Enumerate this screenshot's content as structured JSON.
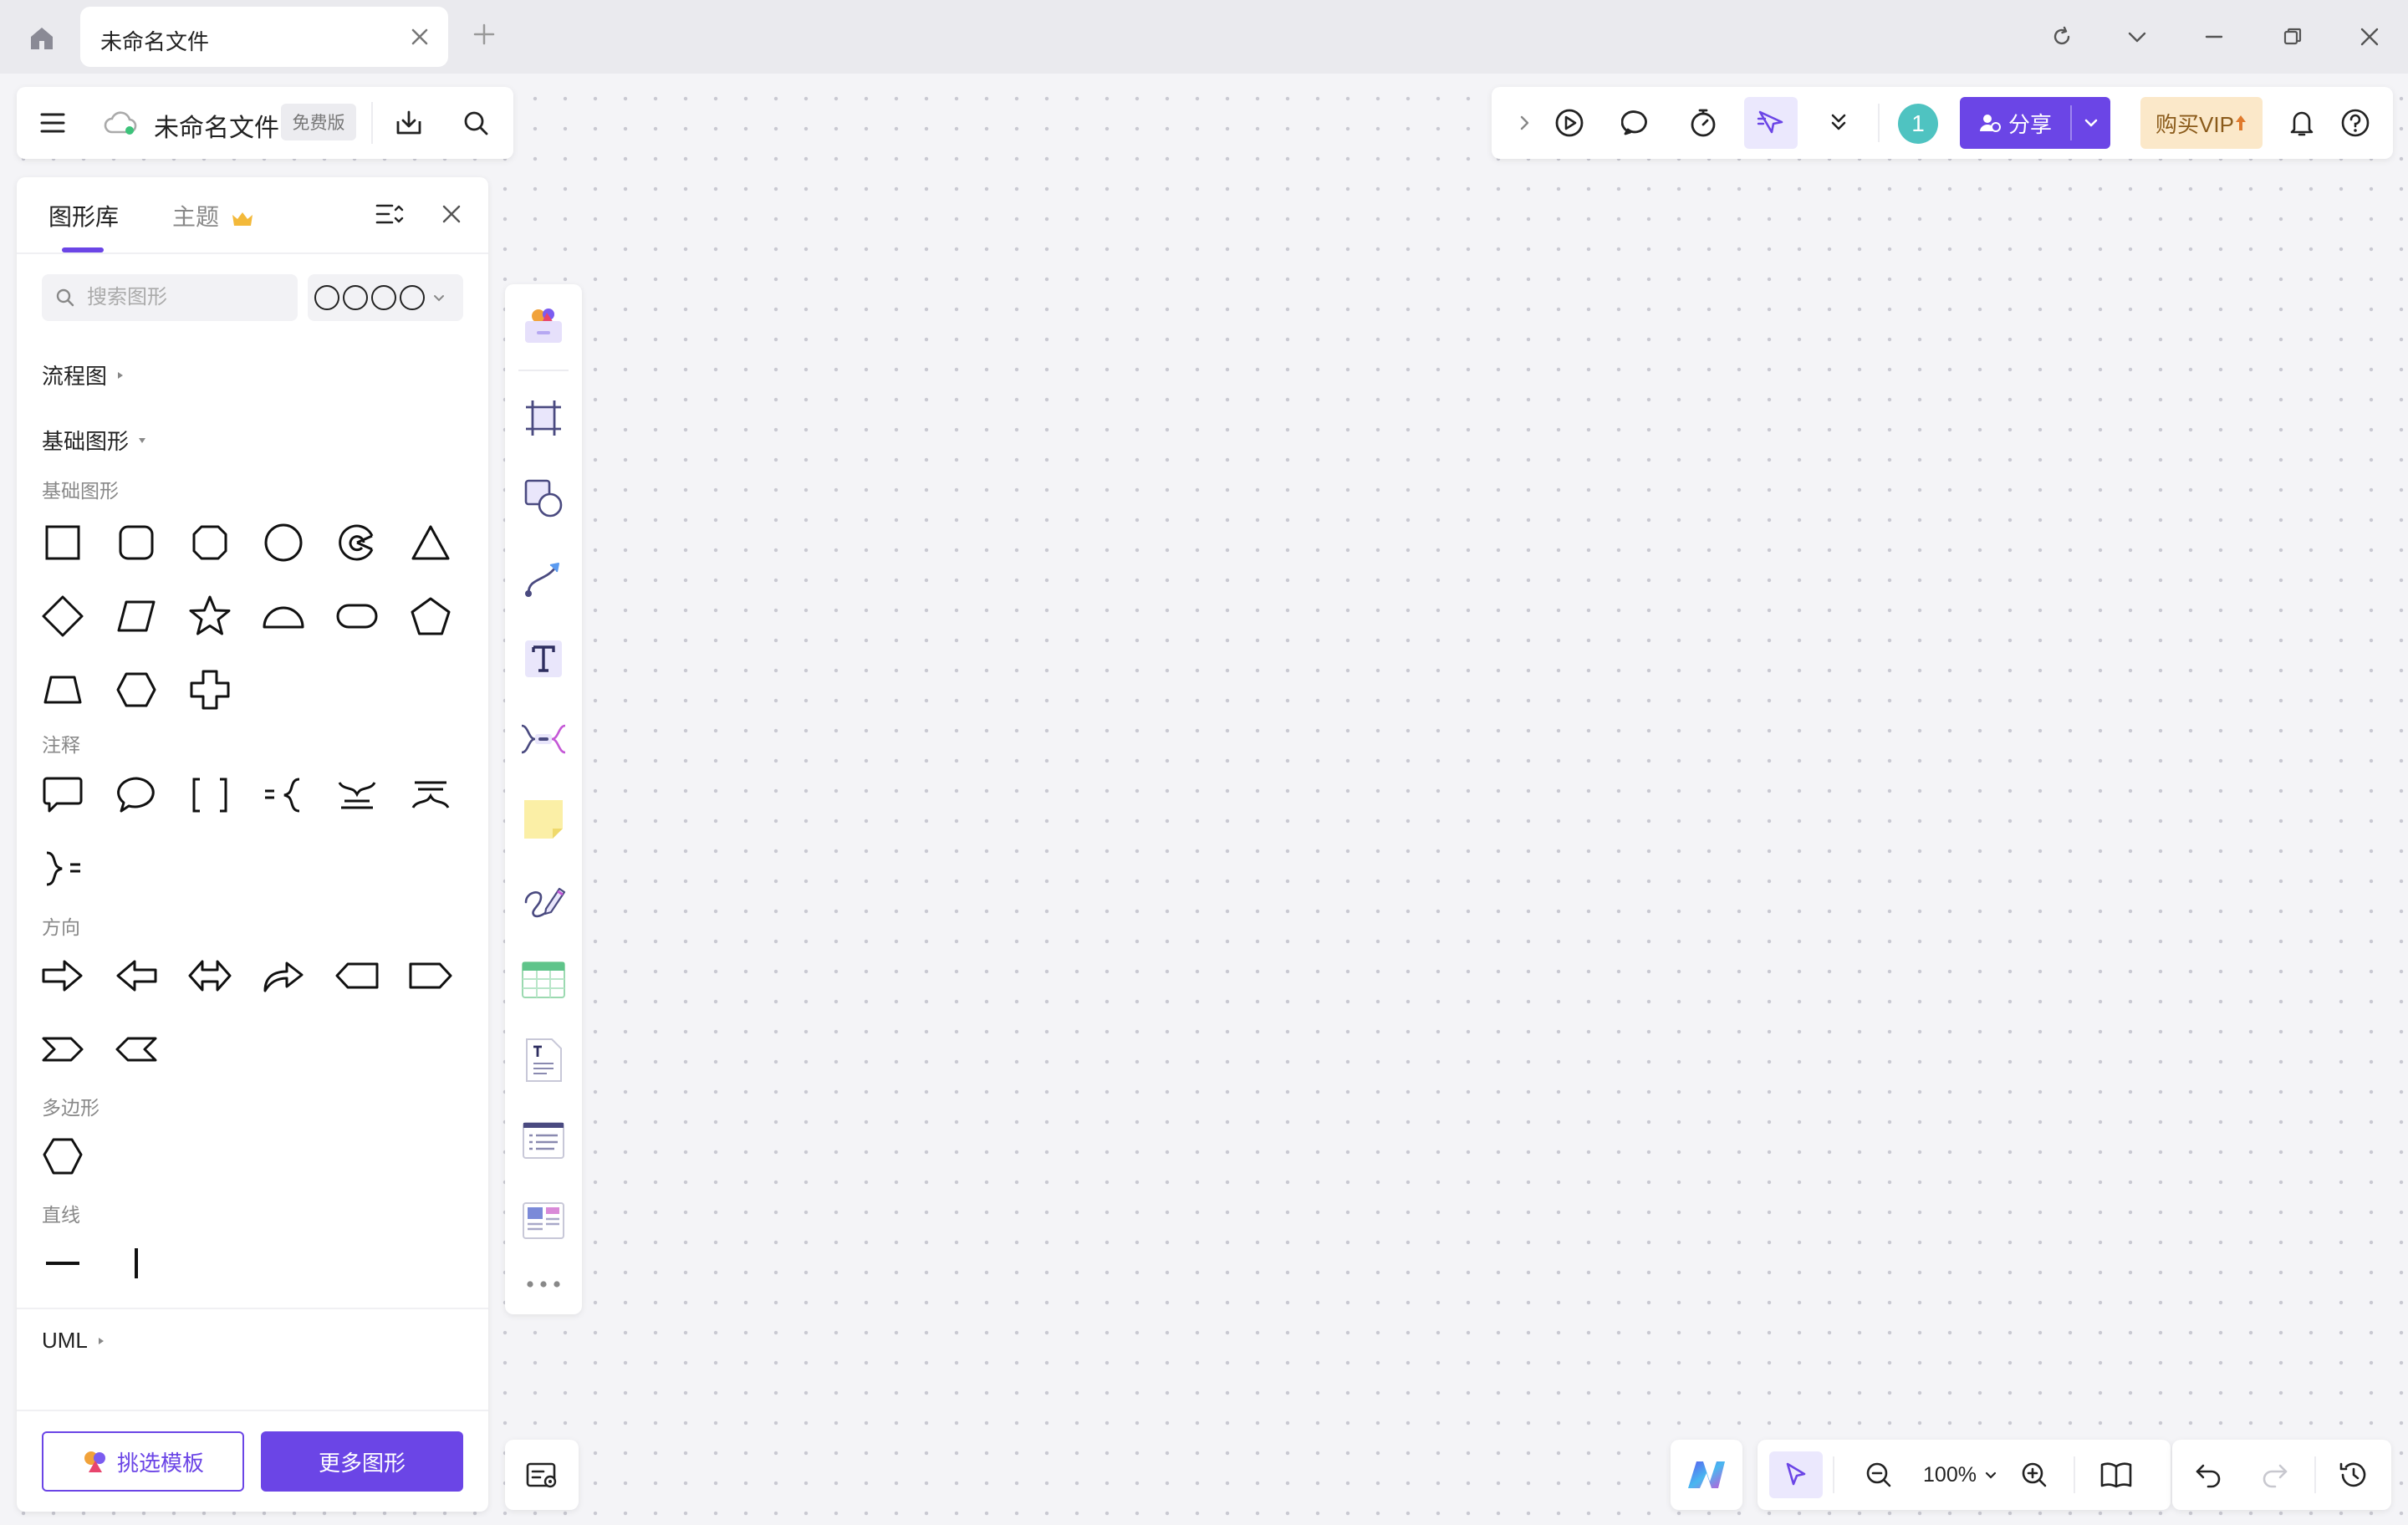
{
  "window": {
    "tab_title": "未命名文件"
  },
  "header": {
    "file_name": "未命名文件",
    "plan_badge": "免费版"
  },
  "toolbar_right": {
    "avatar_count": "1",
    "share_label": "分享",
    "vip_label": "购买VIP"
  },
  "panel": {
    "tabs": [
      {
        "label": "图形库",
        "active": true
      },
      {
        "label": "主题",
        "active": false
      }
    ],
    "search_placeholder": "搜索图形",
    "sections": {
      "flowchart": "流程图",
      "basic": "基础图形",
      "uml": "UML"
    },
    "subsections": {
      "basic": "基础图形",
      "annotation": "注释",
      "direction": "方向",
      "polygon": "多边形",
      "line": "直线"
    },
    "template_button": "挑选模板",
    "more_button": "更多图形"
  },
  "zoom": {
    "level": "100%"
  },
  "colors": {
    "accent": "#6b45e6",
    "avatar": "#4fc3c1",
    "vip_bg": "#fbe8c9",
    "vip_text": "#8a5a1a"
  }
}
